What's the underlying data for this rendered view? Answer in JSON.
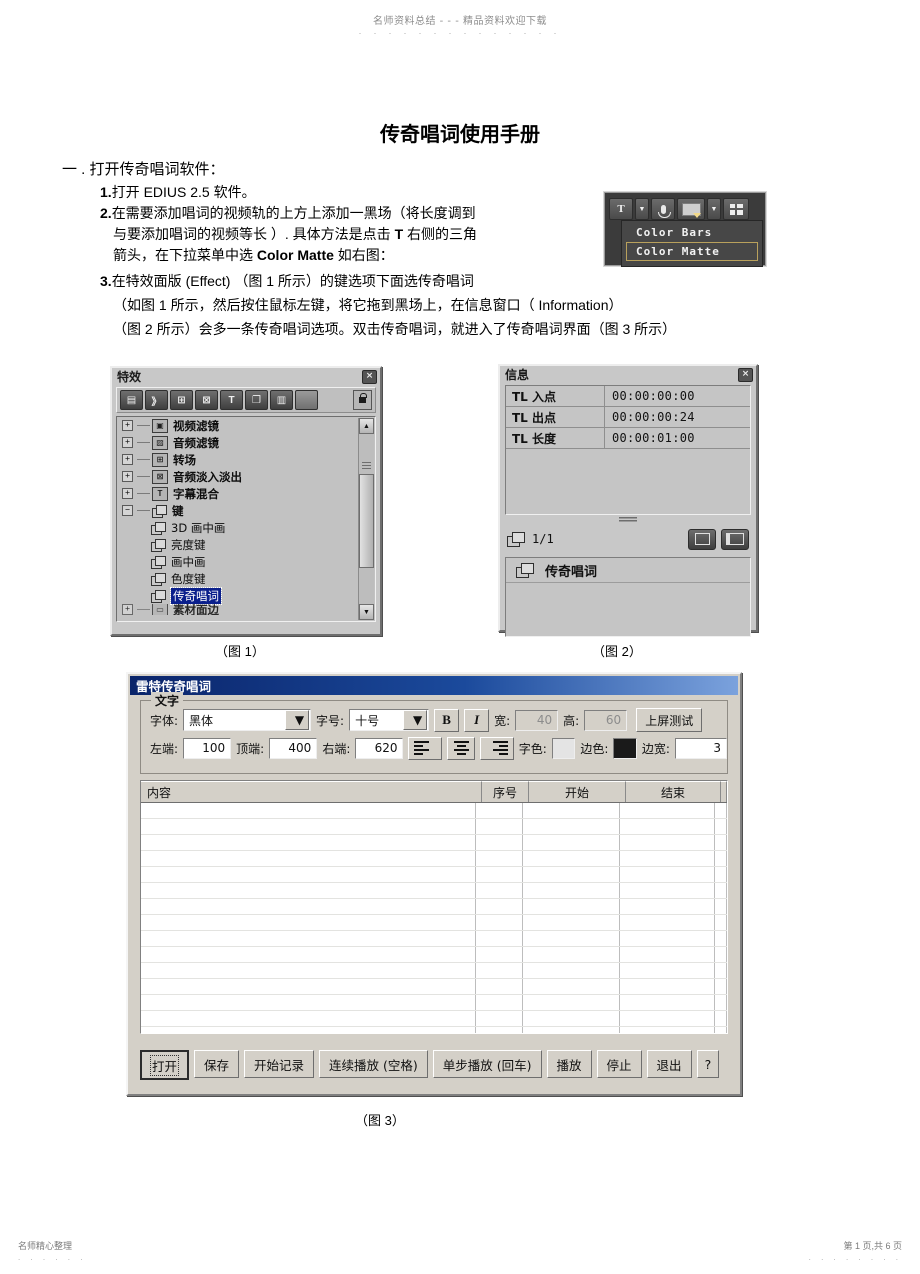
{
  "watermark": {
    "header": "名师资料总结 - - - 精品资料欢迎下载",
    "header_dots": ". . . . . . . . . . . . . .",
    "footer_left": "名师精心整理",
    "footer_left_dots": ". . . . . .",
    "footer_right": "第 1 页,共 6 页",
    "footer_right_dots": ". . . . . . . ."
  },
  "document": {
    "title": "传奇唱词使用手册",
    "section_heading": "一 . 打开传奇唱词软件：",
    "items": {
      "item1": {
        "num": "1.",
        "text": "打开 EDIUS 2.5 软件。"
      },
      "item2": {
        "num": "2.",
        "line1": "在需要添加唱词的视频轨的上方上添加一黑场（将长度调到",
        "line2_a": "与要添加唱词的视频等长  ）. 具体方法是点击  ",
        "line2_bold": "T",
        "line2_b": " 右侧的三角",
        "line3_a": "箭头，在下拉菜单中选  ",
        "line3_bold": "Color Matte",
        "line3_b": " 如右图："
      },
      "item3": {
        "num": "3.",
        "line1": "在特效面版 (Effect) （图 1 所示）的键选项下面选传奇唱词",
        "line2": "（如图 1 所示，然后按住鼠标左键，将它拖到黑场上，在信息窗口（      Information）",
        "line3": "（图 2 所示）会多一条传奇唱词选项。双击传奇唱词，就进入了传奇唱词界面（图      3 所示）"
      }
    },
    "captions": {
      "fig1": "（图  1）",
      "fig2": "（图  2）",
      "fig3": "（图  3）"
    }
  },
  "toolbar_shot": {
    "title_icon": "T",
    "menu": [
      {
        "label": "Color Bars",
        "selected": false
      },
      {
        "label": "Color Matte",
        "selected": true
      }
    ]
  },
  "effect_panel": {
    "title": "特效",
    "close_label": "×",
    "toolbar_icons": [
      "filmstrip-icon",
      "transition-icon",
      "audio-filter-icon",
      "audio-fade-icon",
      "title-mix-icon",
      "key-icon",
      "clip-icon",
      "blank-icon"
    ],
    "lock_icon": "lock-icon",
    "tree": [
      {
        "label": "视频滤镜",
        "level": 1,
        "expander": "+",
        "selected": false
      },
      {
        "label": "音频滤镜",
        "level": 1,
        "expander": "+",
        "selected": false
      },
      {
        "label": "转场",
        "level": 1,
        "expander": "+",
        "selected": false
      },
      {
        "label": "音频淡入淡出",
        "level": 1,
        "expander": "+",
        "selected": false
      },
      {
        "label": "字幕混合",
        "level": 1,
        "expander": "T",
        "selected": false
      },
      {
        "label": "键",
        "level": 1,
        "expander": "−",
        "selected": false
      },
      {
        "label": "3D 画中画",
        "level": 2,
        "expander": "",
        "selected": false
      },
      {
        "label": "亮度键",
        "level": 2,
        "expander": "",
        "selected": false
      },
      {
        "label": "画中画",
        "level": 2,
        "expander": "",
        "selected": false
      },
      {
        "label": "色度键",
        "level": 2,
        "expander": "",
        "selected": false
      },
      {
        "label": "传奇唱词",
        "level": 2,
        "expander": "",
        "selected": true
      },
      {
        "label": "素材面边",
        "level": 1,
        "expander": "+",
        "selected": false
      }
    ]
  },
  "info_panel": {
    "title": "信息",
    "close_label": "×",
    "rows": [
      {
        "key": "TL 入点",
        "value": "00:00:00:00"
      },
      {
        "key": "TL 出点",
        "value": "00:00:00:24"
      },
      {
        "key": "TL 长度",
        "value": "00:00:01:00"
      }
    ],
    "page_count": "1/1",
    "list_items": [
      {
        "label": "传奇唱词"
      }
    ]
  },
  "app_window": {
    "title": "雷特传奇唱词",
    "text_group": {
      "legend": "文字",
      "font_label": "字体:",
      "font_value": "黑体",
      "size_label": "字号:",
      "size_value": "十号",
      "bold_label": "B",
      "italic_label": "I",
      "width_label": "宽:",
      "width_value": "40",
      "height_label": "高:",
      "height_value": "60",
      "preview_button": "上屏测试",
      "left_label": "左端:",
      "left_value": "100",
      "top_label": "顶端:",
      "top_value": "400",
      "right_label": "右端:",
      "right_value": "620",
      "textcolor_label": "字色:",
      "textcolor_value": "#e4e4e4",
      "edgecolor_label": "边色:",
      "edgecolor_value": "#1a1a1a",
      "edgewidth_label": "边宽:",
      "edgewidth_value": "3"
    },
    "grid": {
      "columns": [
        "内容",
        "序号",
        "开始",
        "结束",
        ""
      ],
      "row_count": 15,
      "rows": []
    },
    "buttons": [
      {
        "label": "打开",
        "focused": true
      },
      {
        "label": "保存",
        "focused": false
      },
      {
        "label": "开始记录",
        "focused": false
      },
      {
        "label": "连续播放 (空格)",
        "focused": false
      },
      {
        "label": "单步播放 (回车)",
        "focused": false
      },
      {
        "label": "播放",
        "focused": false
      },
      {
        "label": "停止",
        "focused": false
      },
      {
        "label": "退出",
        "focused": false
      },
      {
        "label": "?",
        "focused": false
      }
    ]
  }
}
